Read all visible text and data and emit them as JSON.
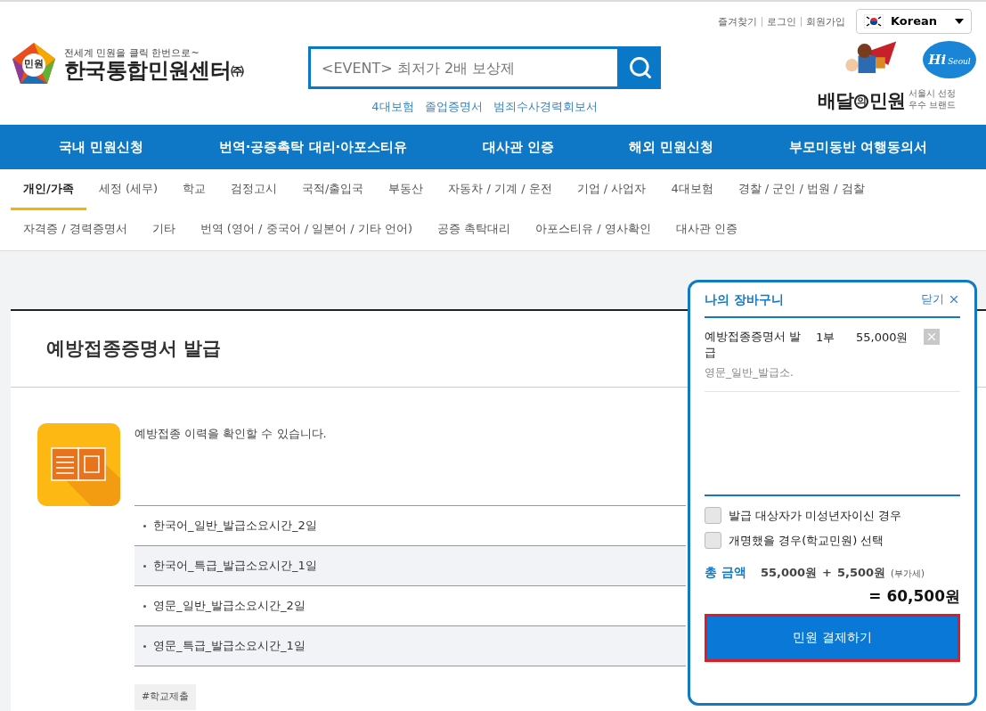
{
  "top_links": [
    "즐겨찾기",
    "로그인",
    "회원가입"
  ],
  "language": {
    "label": "Korean"
  },
  "logo": {
    "badge": "민원",
    "tagline": "전세계 민원을 클릭 한번으로~",
    "name": "한국통합민원센터",
    "suffix": "㈜"
  },
  "search": {
    "placeholder": "<EVENT> 최저가 2배 보상제"
  },
  "quick_links": [
    "4대보험",
    "졸업증명서",
    "범죄수사경력회보서"
  ],
  "brand": {
    "name_parts": [
      "배달",
      "의",
      "민원"
    ],
    "caption": [
      "서울시 선정",
      "우수 브랜드"
    ],
    "seal": [
      "Hi",
      "Seoul"
    ]
  },
  "main_nav": [
    "국내 민원신청",
    "번역·공증촉탁 대리·아포스티유",
    "대사관 인증",
    "해외 민원신청",
    "부모미동반 여행동의서"
  ],
  "category_rows": [
    [
      {
        "label": "개인/가족",
        "selected": true
      },
      {
        "label": "세정 (세무)",
        "selected": false
      },
      {
        "label": "학교",
        "selected": false
      },
      {
        "label": "검정고시",
        "selected": false
      },
      {
        "label": "국적/출입국",
        "selected": false
      },
      {
        "label": "부동산",
        "selected": false
      },
      {
        "label": "자동차 / 기계 / 운전",
        "selected": false
      },
      {
        "label": "기업 / 사업자",
        "selected": false
      },
      {
        "label": "4대보험",
        "selected": false
      },
      {
        "label": "경찰 / 군인 / 법원 / 검찰",
        "selected": false
      }
    ],
    [
      {
        "label": "자격증 / 경력증명서",
        "selected": false
      },
      {
        "label": "기타",
        "selected": false
      },
      {
        "label": "번역 (영어 / 중국어 / 일본어 / 기타 언어)",
        "selected": false
      },
      {
        "label": "공증 촉탁대리",
        "selected": false
      },
      {
        "label": "아포스티유 / 영사확인",
        "selected": false
      },
      {
        "label": "대사관 인증",
        "selected": false
      }
    ]
  ],
  "page": {
    "title": "예방접종증명서 발급",
    "description": "예방접종 이력을 확인할 수 있습니다.",
    "options": [
      "한국어_일반_발급소요시간_2일",
      "한국어_특급_발급소요시간_1일",
      "영문_일반_발급소요시간_2일",
      "영문_특급_발급소요시간_1일"
    ],
    "tags": [
      "#학교제출"
    ]
  },
  "cart": {
    "title": "나의 장바구니",
    "close": "닫기",
    "items": [
      {
        "name": "예방접종증명서 발급",
        "qty": "1부",
        "price": "55,000원",
        "option": "영문_일반_발급소."
      }
    ],
    "checks": [
      {
        "label": "발급 대상자가 미성년자이신 경우",
        "checked": false
      },
      {
        "label": "개명했을 경우(학교민원) 선택",
        "checked": false
      }
    ],
    "total_label": "총 금액",
    "subtotal": "55,000원",
    "plus": "+",
    "vat": "5,500원",
    "vat_note": "(부가세)",
    "total": "= 60,500원",
    "pay": "민원 결제하기"
  }
}
